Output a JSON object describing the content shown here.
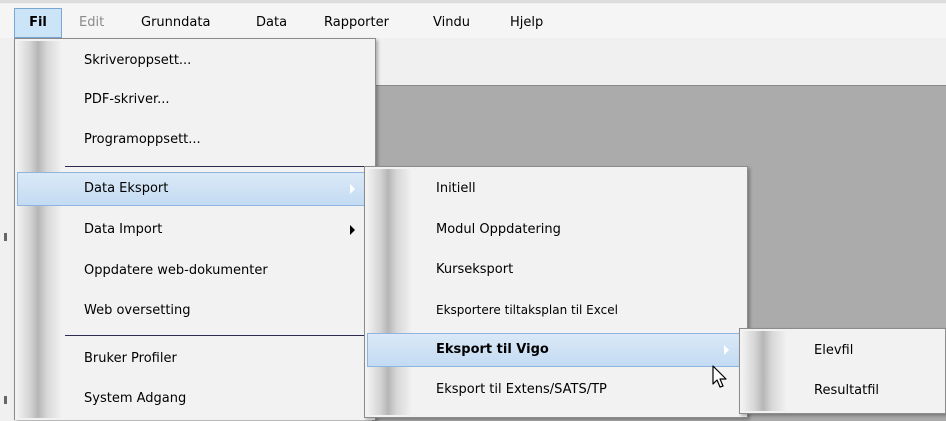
{
  "menubar": {
    "items": [
      {
        "label": "Fil"
      },
      {
        "label": "Edit"
      },
      {
        "label": "Grunndata"
      },
      {
        "label": "Data"
      },
      {
        "label": "Rapporter"
      },
      {
        "label": "Vindu"
      },
      {
        "label": "Hjelp"
      }
    ]
  },
  "fil_menu": {
    "items": [
      {
        "label": "Skriveroppsett..."
      },
      {
        "label": "PDF-skriver..."
      },
      {
        "label": "Programoppsett..."
      },
      {
        "label": "Data Eksport"
      },
      {
        "label": "Data Import"
      },
      {
        "label": "Oppdatere web-dokumenter"
      },
      {
        "label": "Web oversetting"
      },
      {
        "label": "Bruker Profiler"
      },
      {
        "label": "System Adgang"
      }
    ]
  },
  "data_eksport_menu": {
    "items": [
      {
        "label": "Initiell"
      },
      {
        "label": "Modul Oppdatering"
      },
      {
        "label": "Kurseksport"
      },
      {
        "label": "Eksportere tiltaksplan til Excel"
      },
      {
        "label": "Eksport til Vigo"
      },
      {
        "label": "Eksport til Extens/SATS/TP"
      }
    ]
  },
  "vigo_menu": {
    "items": [
      {
        "label": "Elevfil"
      },
      {
        "label": "Resultatfil"
      }
    ]
  },
  "icons": {
    "submenu_arrow": "chevron-right-icon",
    "cursor": "mouse-pointer-icon"
  },
  "colors": {
    "highlight": "#c3dbf3",
    "highlight_border": "#8fb5de",
    "workspace": "#ababab",
    "separator": "#2b2b52"
  }
}
